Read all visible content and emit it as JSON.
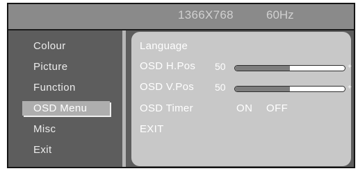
{
  "header": {
    "resolution": "1366X768",
    "refresh_rate": "60Hz"
  },
  "menu": {
    "items": [
      {
        "label": "Colour",
        "selected": false
      },
      {
        "label": "Picture",
        "selected": false
      },
      {
        "label": "Function",
        "selected": false
      },
      {
        "label": "OSD Menu",
        "selected": true
      },
      {
        "label": "Misc",
        "selected": false
      },
      {
        "label": "Exit",
        "selected": false
      }
    ]
  },
  "panel": {
    "language": {
      "label": "Language"
    },
    "h_pos": {
      "label": "OSD H.Pos",
      "value": "50",
      "plus": "+",
      "level": 0.5
    },
    "v_pos": {
      "label": "OSD V.Pos",
      "value": "50",
      "plus": "+",
      "level": 0.5
    },
    "timer": {
      "label": "OSD Timer",
      "on": "ON",
      "off": "OFF"
    },
    "exit": {
      "label": "EXIT"
    }
  },
  "colors": {
    "bezel": "#5d5d5d",
    "header": "#8a8a8a",
    "panel": "#c8c8c8",
    "highlight": "#aeaeae",
    "text": "#ffffff"
  }
}
